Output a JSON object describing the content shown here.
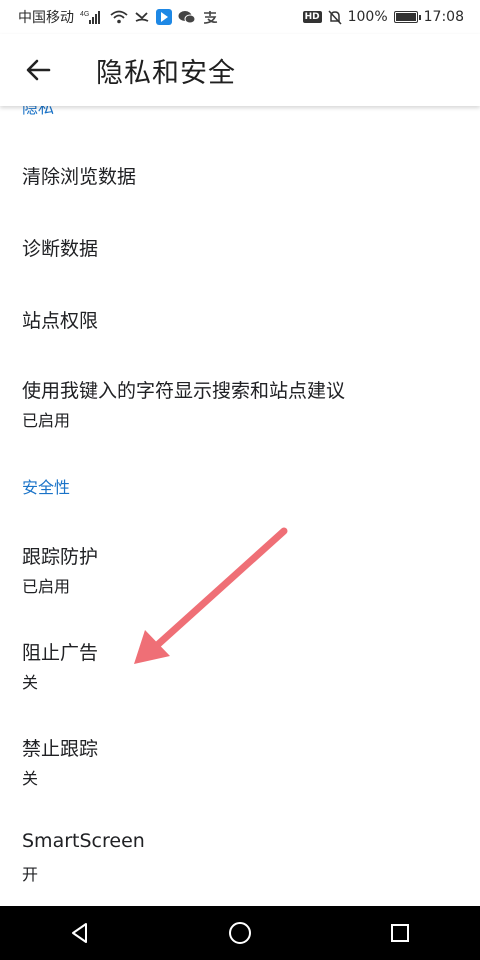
{
  "status_bar": {
    "carrier": "中国移动",
    "network": "4G",
    "hd_badge": "HD",
    "battery": "100%",
    "battery_level": 1.0,
    "time": "17:08"
  },
  "toolbar": {
    "title": "隐私和安全"
  },
  "sections": {
    "privacy": {
      "header": "隐私"
    },
    "security": {
      "header": "安全性"
    }
  },
  "items": {
    "clear_browsing_data": {
      "title": "清除浏览数据"
    },
    "diagnostic_data": {
      "title": "诊断数据"
    },
    "site_permissions": {
      "title": "站点权限"
    },
    "search_suggestions": {
      "title": "使用我键入的字符显示搜索和站点建议",
      "status": "已启用"
    },
    "tracking_prevention": {
      "title": "跟踪防护",
      "status": "已启用"
    },
    "block_ads": {
      "title": "阻止广告",
      "status": "关"
    },
    "do_not_track": {
      "title": "禁止跟踪",
      "status": "关"
    },
    "smartscreen": {
      "title": "SmartScreen",
      "status": "开"
    }
  },
  "colors": {
    "accent": "#1a73c8",
    "annotation_arrow": "#ef6f76"
  },
  "icons": {
    "back": "arrow-left-icon",
    "nav_back": "triangle-back-icon",
    "nav_home": "circle-home-icon",
    "nav_recents": "square-recents-icon"
  }
}
